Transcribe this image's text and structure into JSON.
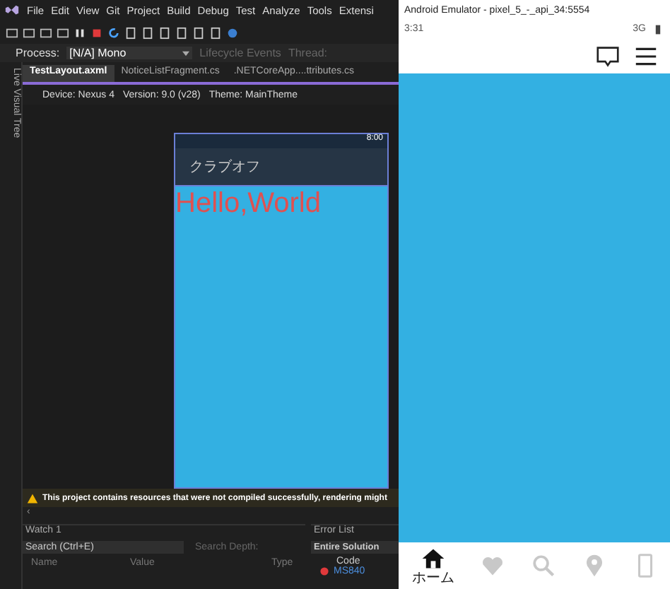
{
  "ide": {
    "menu": [
      "File",
      "Edit",
      "View",
      "Git",
      "Project",
      "Build",
      "Debug",
      "Test",
      "Analyze",
      "Tools",
      "Extensi"
    ],
    "process": {
      "label": "Process:",
      "value": "[N/A] Mono",
      "lifecycle": "Lifecycle Events",
      "thread": "Thread:"
    },
    "side_tab": "Live Visual Tree",
    "tabs": [
      {
        "label": "TestLayout.axml",
        "selected": true
      },
      {
        "label": "NoticeListFragment.cs",
        "selected": false
      },
      {
        "label": ".NETCoreApp....ttributes.cs",
        "selected": false
      }
    ],
    "device_bar": [
      "Device: Nexus 4",
      "Version: 9.0 (v28)",
      "Theme: MainTheme"
    ],
    "preview": {
      "time": "8:00",
      "title": "クラブオフ",
      "text": "Hello,World"
    },
    "warning": "This project contains resources that were not compiled successfully, rendering might",
    "scroll_mark": "‹",
    "watch": {
      "title": "Watch 1",
      "search": "Search (Ctrl+E)",
      "depth": "Search Depth:",
      "columns": [
        "Name",
        "Value",
        "Type"
      ]
    },
    "errors": {
      "title": "Error List",
      "scope": "Entire Solution",
      "column": "Code",
      "row": "MS840"
    }
  },
  "emulator": {
    "title": "Android Emulator - pixel_5_-_api_34:5554",
    "time": "3:31",
    "network": "3G",
    "nav": [
      {
        "kind": "home",
        "label": "ホーム",
        "selected": true
      },
      {
        "kind": "heart",
        "selected": false
      },
      {
        "kind": "search",
        "selected": false
      },
      {
        "kind": "pin",
        "selected": false
      },
      {
        "kind": "phone",
        "selected": false
      }
    ]
  }
}
